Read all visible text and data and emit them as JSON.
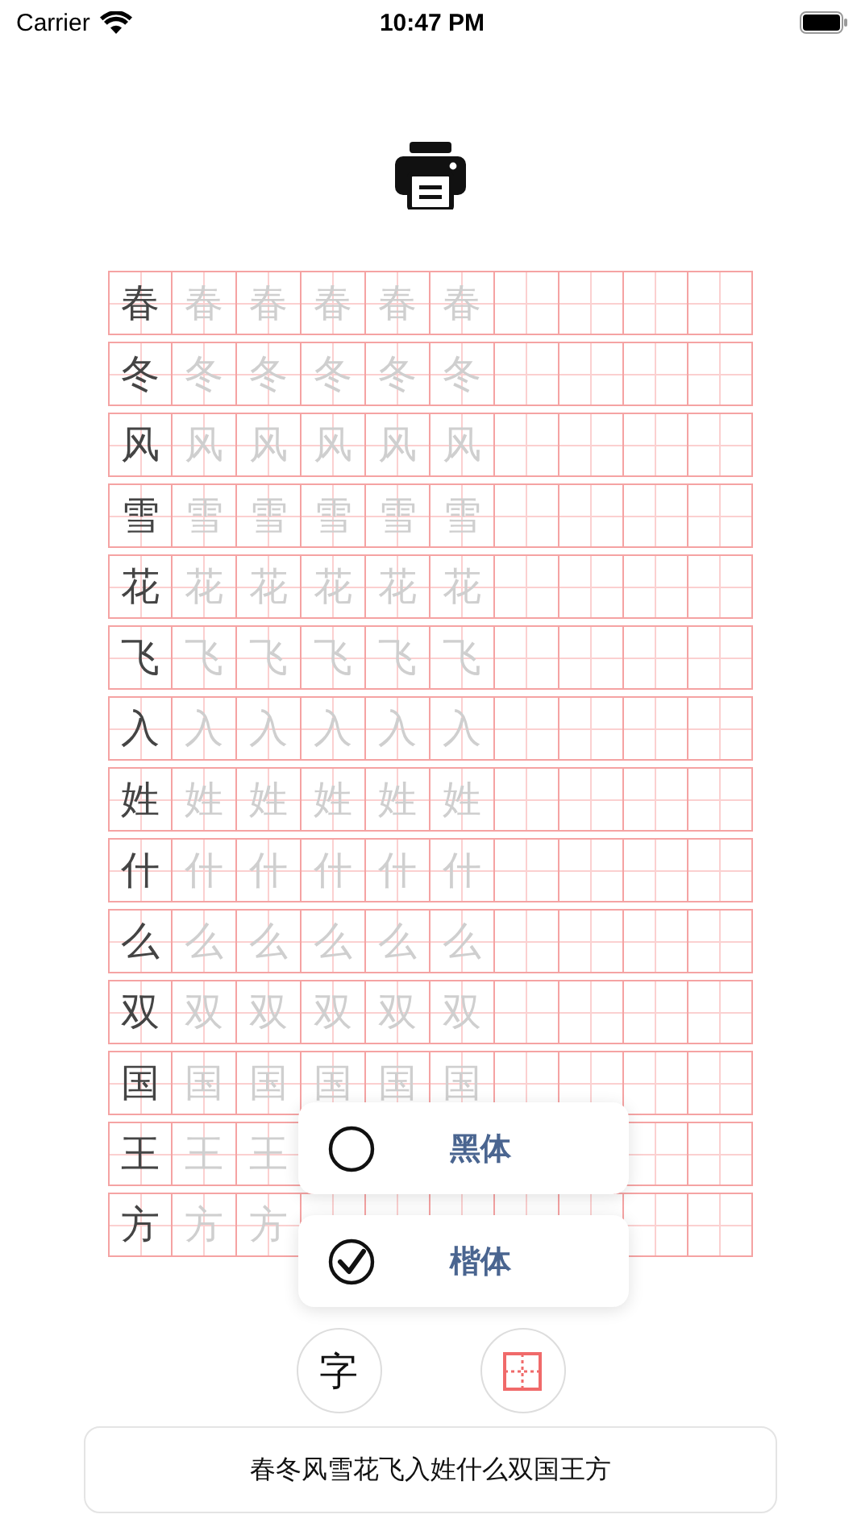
{
  "status_bar": {
    "carrier": "Carrier",
    "time": "10:47 PM"
  },
  "rows": [
    {
      "char": "春",
      "traces": [
        "春",
        "春",
        "春",
        "春",
        "春"
      ]
    },
    {
      "char": "冬",
      "traces": [
        "冬",
        "冬",
        "冬",
        "冬",
        "冬"
      ]
    },
    {
      "char": "风",
      "traces": [
        "风",
        "风",
        "风",
        "风",
        "风"
      ]
    },
    {
      "char": "雪",
      "traces": [
        "雪",
        "雪",
        "雪",
        "雪",
        "雪"
      ]
    },
    {
      "char": "花",
      "traces": [
        "花",
        "花",
        "花",
        "花",
        "花"
      ]
    },
    {
      "char": "飞",
      "traces": [
        "飞",
        "飞",
        "飞",
        "飞",
        "飞"
      ]
    },
    {
      "char": "入",
      "traces": [
        "入",
        "入",
        "入",
        "入",
        "入"
      ]
    },
    {
      "char": "姓",
      "traces": [
        "姓",
        "姓",
        "姓",
        "姓",
        "姓"
      ]
    },
    {
      "char": "什",
      "traces": [
        "什",
        "什",
        "什",
        "什",
        "什"
      ]
    },
    {
      "char": "么",
      "traces": [
        "么",
        "么",
        "么",
        "么",
        "么"
      ]
    },
    {
      "char": "双",
      "traces": [
        "双",
        "双",
        "双",
        "双",
        "双"
      ]
    },
    {
      "char": "国",
      "traces": [
        "国",
        "国",
        "国",
        "国",
        "国"
      ]
    },
    {
      "char": "王",
      "traces": [
        "王",
        "王"
      ]
    },
    {
      "char": "方",
      "traces": [
        "方",
        "方"
      ]
    }
  ],
  "font_menu": [
    {
      "label": "黑体",
      "selected": false
    },
    {
      "label": "楷体",
      "selected": true
    }
  ],
  "tool_buttons": [
    {
      "kind": "text",
      "label": "字"
    },
    {
      "kind": "grid"
    }
  ],
  "text_field": {
    "value": "春冬风雪花飞入姓什么双国王方"
  }
}
